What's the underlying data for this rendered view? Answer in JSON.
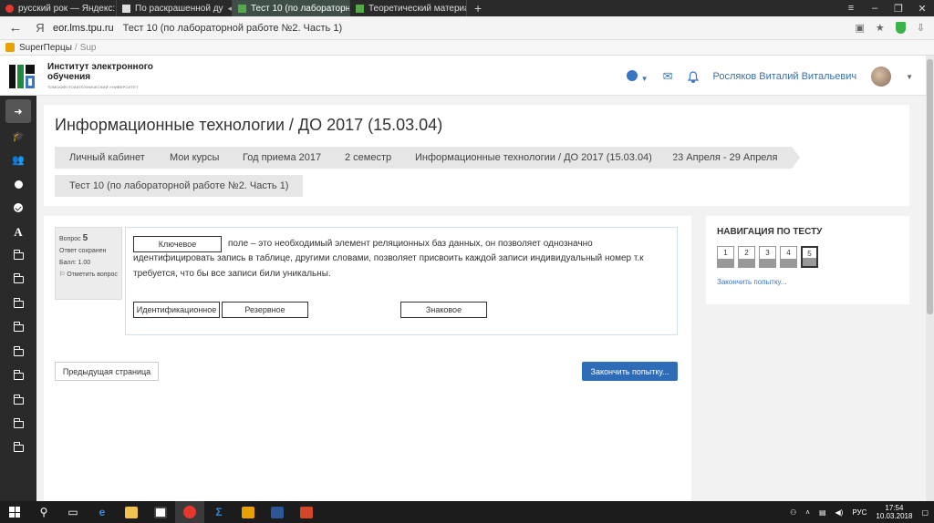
{
  "browser": {
    "tabs": [
      {
        "label": "русский рок — Яндекс: най",
        "favicon_color": "#e8382d",
        "active": false,
        "muted": false
      },
      {
        "label": "По раскрашенной ду",
        "favicon_color": "#dddddd",
        "active": false,
        "muted": true
      },
      {
        "label": "Тест 10 (по лабораторн",
        "favicon_color": "#53a848",
        "active": true,
        "muted": false
      },
      {
        "label": "Теоретический материал п",
        "favicon_color": "#53a848",
        "active": false,
        "muted": false
      }
    ],
    "close_glyph": "×",
    "new_tab_glyph": "+",
    "address": {
      "host": "eor.lms.tpu.ru",
      "page_title": "Тест 10 (по лабораторной работе №2. Часть 1)"
    },
    "bookmarks": [
      {
        "label": "SuperПерцы"
      },
      {
        "label": "Sup"
      }
    ]
  },
  "site": {
    "logo_title": "Институт электронного обучения",
    "logo_subtitle": "ТОМСКИЙ ПОЛИТЕХНИЧЕСКИЙ УНИВЕРСИТЕТ",
    "user_name": "Росляков Виталий Витальевич",
    "brand_color": "#3a75c4"
  },
  "sidebar": {
    "items": [
      {
        "icon": "arrow-right-circle-icon"
      },
      {
        "icon": "graduation-cap-icon"
      },
      {
        "icon": "users-icon"
      },
      {
        "icon": "dot-icon"
      },
      {
        "icon": "check-icon"
      },
      {
        "icon": "font-icon",
        "glyph": "A"
      },
      {
        "icon": "folder-icon"
      },
      {
        "icon": "folder-icon"
      },
      {
        "icon": "folder-icon"
      },
      {
        "icon": "folder-icon"
      },
      {
        "icon": "folder-icon"
      },
      {
        "icon": "folder-icon"
      },
      {
        "icon": "folder-icon"
      },
      {
        "icon": "folder-icon"
      },
      {
        "icon": "folder-icon"
      }
    ]
  },
  "course": {
    "title": "Информационные технологии / ДО 2017 (15.03.04)",
    "breadcrumbs": [
      "Личный кабинет",
      "Мои курсы",
      "Год приема 2017",
      "2 семестр",
      "Информационные технологии / ДО 2017 (15.03.04)",
      "23 Апреля - 29 Апреля",
      "Тест 10 (по лабораторной работе №2. Часть 1)"
    ]
  },
  "question": {
    "label": "Вопрос",
    "number": "5",
    "status": "Ответ сохранен",
    "points": "Балл: 1.00",
    "flag_label": "Отметить вопрос",
    "answer_box": "Ключевое",
    "text_line1": "поле – это необходимый элемент реляционных баз данных, он позволяет однозначно",
    "text_line2": "идентифицировать запись в таблице, другими словами,  позволяет присвоить каждой записи индивидуальный номер т.к",
    "text_line3": "требуется, что бы все записи били уникальны.",
    "options": [
      "Идентификационное",
      "Резервное",
      "Знаковое"
    ]
  },
  "actions": {
    "prev_page": "Предыдущая страница",
    "finish_attempt": "Закончить попытку..."
  },
  "quiz_nav": {
    "title": "НАВИГАЦИЯ ПО ТЕСТУ",
    "buttons": [
      "1",
      "2",
      "3",
      "4",
      "5"
    ],
    "current": 5,
    "finish_link": "Закончить попытку..."
  },
  "taskbar": {
    "lang": "РУС",
    "time": "17:54",
    "date": "10.03.2018"
  }
}
